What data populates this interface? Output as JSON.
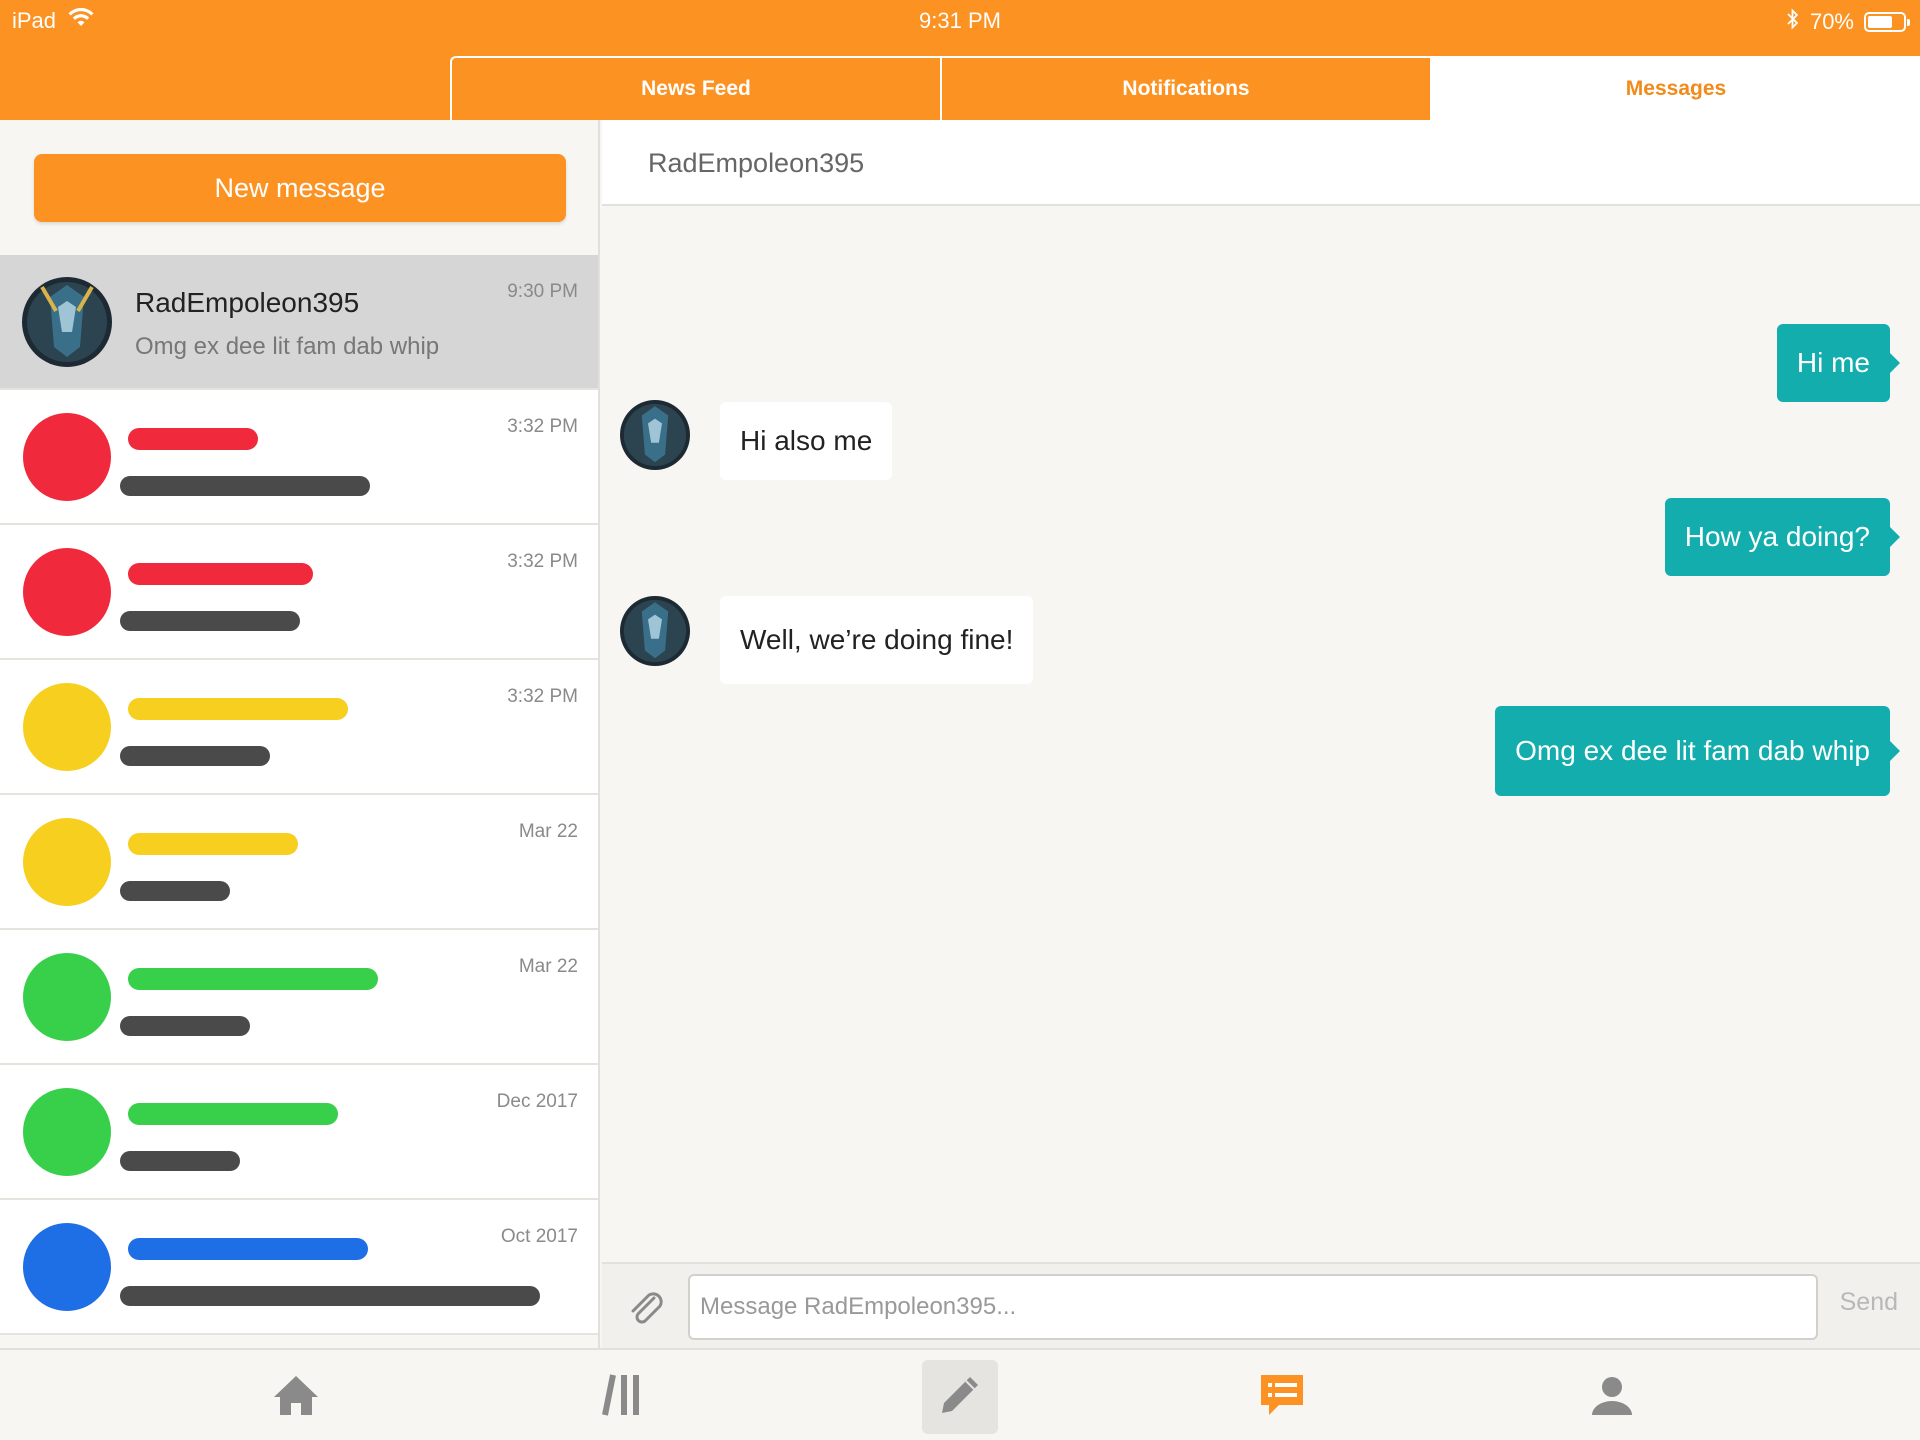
{
  "status_bar": {
    "device": "iPad",
    "time": "9:31 PM",
    "battery": "70%",
    "battery_level": 0.7
  },
  "tabs": [
    {
      "label": "News Feed",
      "active": false
    },
    {
      "label": "Notifications",
      "active": false
    },
    {
      "label": "Messages",
      "active": true
    }
  ],
  "sidebar": {
    "new_message_label": "New message",
    "conversations": [
      {
        "name": "RadEmpoleon395",
        "preview": "Omg ex dee lit fam dab whip",
        "time": "9:30 PM",
        "selected": true,
        "redacted": false
      },
      {
        "time": "3:32 PM",
        "redacted": true,
        "scribble_color": "#f02a3c"
      },
      {
        "time": "3:32 PM",
        "redacted": true,
        "scribble_color": "#f02a3c"
      },
      {
        "time": "3:32 PM",
        "redacted": true,
        "scribble_color": "#f7cf1f"
      },
      {
        "time": "Mar 22",
        "redacted": true,
        "scribble_color": "#f7cf1f"
      },
      {
        "time": "Mar 22",
        "redacted": true,
        "scribble_color": "#38cf4a"
      },
      {
        "time": "Dec 2017",
        "redacted": true,
        "scribble_color": "#38cf4a"
      },
      {
        "time": "Oct 2017",
        "redacted": true,
        "scribble_color": "#1e6fe6"
      }
    ]
  },
  "chat": {
    "title": "RadEmpoleon395",
    "messages": [
      {
        "from": "me",
        "text": "Hi me"
      },
      {
        "from": "them",
        "text": "Hi also me"
      },
      {
        "from": "me",
        "text": "How ya doing?"
      },
      {
        "from": "them",
        "text": "Well, we’re doing fine!"
      },
      {
        "from": "me",
        "text": "Omg ex dee lit fam dab whip"
      }
    ],
    "composer": {
      "placeholder": "Message RadEmpoleon395...",
      "send_label": "Send"
    }
  },
  "bottom_nav": [
    {
      "name": "home-icon"
    },
    {
      "name": "library-icon"
    },
    {
      "name": "compose-icon",
      "highlighted": true
    },
    {
      "name": "messages-icon",
      "active": true
    },
    {
      "name": "profile-icon"
    }
  ],
  "colors": {
    "brand": "#fb9222",
    "bubble_me": "#14adad",
    "active_tab_text": "#f28a1a"
  }
}
